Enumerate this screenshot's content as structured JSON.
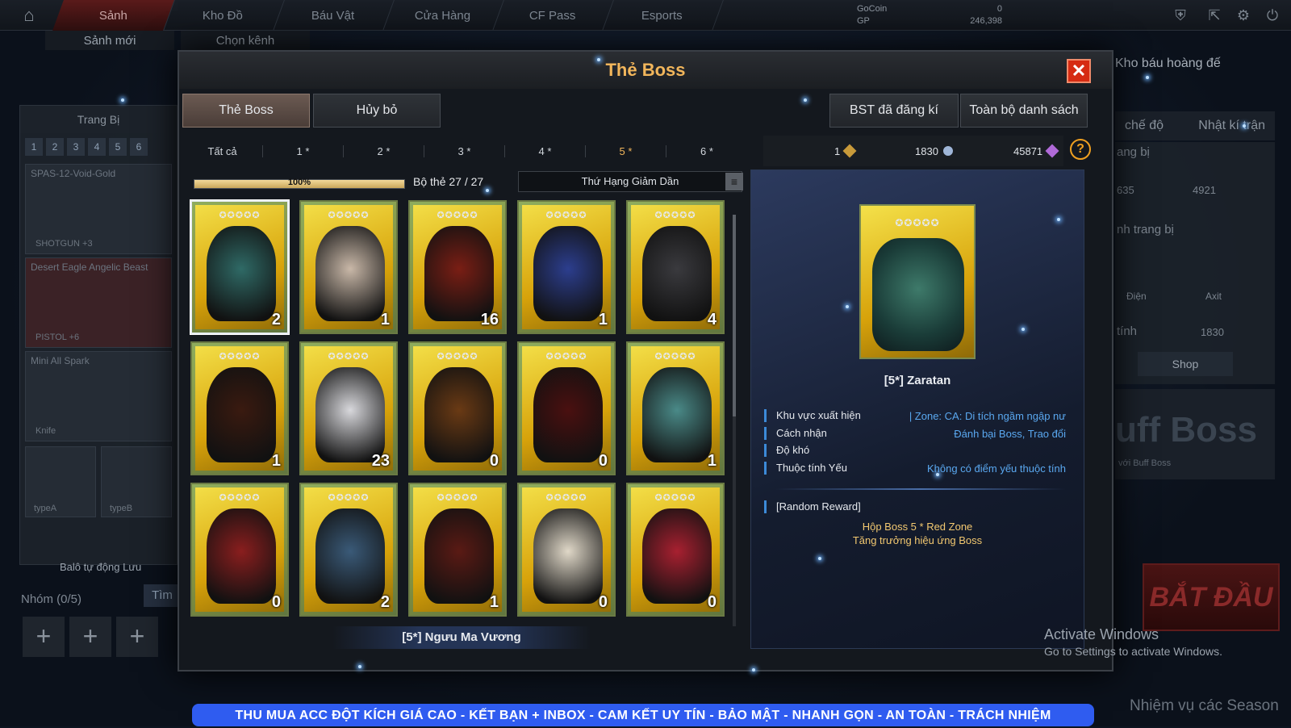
{
  "topbar": {
    "nav": [
      "Sảnh",
      "Kho Đồ",
      "Báu Vật",
      "Cửa Hàng",
      "CF Pass",
      "Esports"
    ],
    "subnav": [
      "Sảnh mới",
      "Chọn kênh"
    ],
    "gocoin_label": "GoCoin",
    "gocoin_value": "0",
    "gp_label": "GP",
    "gp_value": "246,398"
  },
  "left_panel": {
    "title": "Trang Bị",
    "slots": [
      "1",
      "2",
      "3",
      "4",
      "5",
      "6"
    ],
    "items": [
      {
        "name": "SPAS-12-Void-Gold",
        "tag": "SHOTGUN  +3"
      },
      {
        "name": "Desert Eagle Angelic Beast",
        "tag": "PISTOL   +6"
      },
      {
        "name": "Mini All Spark",
        "tag": "Knife"
      }
    ],
    "small": [
      "typeA",
      "typeB"
    ],
    "autosave": "Balô tự động Lưu",
    "group": "Nhóm (0/5)",
    "find": "Tìm"
  },
  "right_panel": {
    "treasure": "Kho báu hoàng đế",
    "tabs": [
      "chế độ",
      "Nhật kí trận"
    ],
    "equip_label": "ang bị",
    "values": [
      "635",
      "4921"
    ],
    "equip_label2": "nh trang bị",
    "elements": [
      "Điện",
      "Axit"
    ],
    "stat_label": "tính",
    "stat_value": "1830",
    "shop": "Shop",
    "buff": "uff Boss",
    "buff_sub": "với Buff Boss",
    "start": "BẮT ĐẦU",
    "season": "Nhiệm vụ các Season"
  },
  "windows": {
    "line1": "Activate Windows",
    "line2": "Go to Settings to activate Windows."
  },
  "banner": "THU MUA ACC ĐỘT KÍCH GIÁ CAO  -  KẾT BẠN + INBOX  -  CAM KẾT UY TÍN - BẢO MẬT - NHANH GỌN - AN TOÀN - TRÁCH NHIỆM",
  "modal": {
    "title": "Thẻ Boss",
    "close": "✕",
    "tabs": {
      "boss_card": "Thẻ Boss",
      "cancel": "Hủy bỏ",
      "registered": "BST đã đăng kí",
      "all_list": "Toàn bộ danh sách"
    },
    "filters": [
      "Tất cả",
      "1 *",
      "2 *",
      "3 *",
      "4 *",
      "5 *",
      "6 *"
    ],
    "selected_filter": 5,
    "currencies": [
      {
        "value": "1",
        "color": "#c89a3a"
      },
      {
        "value": "1830",
        "color": "#9fb6d8"
      },
      {
        "value": "45871",
        "color": "#b06ad8"
      }
    ],
    "help": "?",
    "progress_text": "100%",
    "progress_value": 1.0,
    "set_text": "Bộ thẻ 27 / 27",
    "sort": "Thứ Hạng Giảm Dần",
    "cards": [
      {
        "count": "2",
        "color": "#2f6a66"
      },
      {
        "count": "1",
        "color": "#c9b8a8"
      },
      {
        "count": "16",
        "color": "#7a1e14"
      },
      {
        "count": "1",
        "color": "#2c3e8e"
      },
      {
        "count": "4",
        "color": "#3a3a3e"
      },
      {
        "count": "1",
        "color": "#3a1a10"
      },
      {
        "count": "23",
        "color": "#d8d8dc"
      },
      {
        "count": "0",
        "color": "#6a3a14"
      },
      {
        "count": "0",
        "color": "#4a1010"
      },
      {
        "count": "1",
        "color": "#4a8a88"
      },
      {
        "count": "0",
        "color": "#8a1e1e"
      },
      {
        "count": "2",
        "color": "#3a5a78"
      },
      {
        "count": "1",
        "color": "#5a1a14"
      },
      {
        "count": "0",
        "color": "#e0d8c8"
      },
      {
        "count": "0",
        "color": "#a82030"
      }
    ],
    "stars": "✪✪✪✪✪",
    "hover_name": "[5*] Ngưu Ma Vương",
    "detail": {
      "name": "[5*] Zaratan",
      "rows": [
        {
          "label": "Khu vực xuất hiện",
          "value": "| Zone: CA: Di tích ngầm ngập nư"
        },
        {
          "label": "Cách nhận",
          "value": "Đánh bại Boss, Trao đổi"
        },
        {
          "label": "Độ khó",
          "value": ""
        },
        {
          "label": "Thuộc tính Yếu",
          "value": "Không có điểm yếu thuộc tính"
        }
      ],
      "reward_title": "[Random Reward]",
      "rewards": [
        "Hộp Boss 5 * Red Zone",
        "Tăng trưởng hiệu ứng Boss"
      ]
    }
  }
}
